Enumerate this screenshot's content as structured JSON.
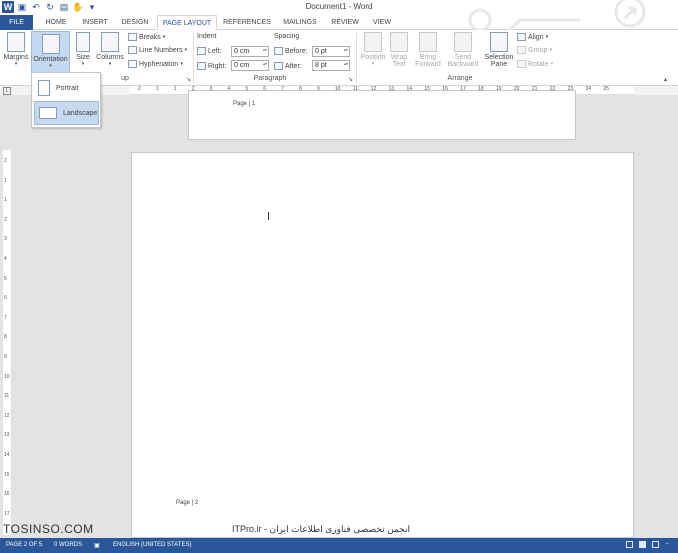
{
  "window": {
    "title": "Document1 - Word"
  },
  "qat": {
    "icons": [
      "word-icon",
      "save-icon",
      "undo-icon",
      "redo-icon",
      "open-icon",
      "touch-mode-icon",
      "customize-icon"
    ]
  },
  "tabs": [
    {
      "label": "FILE"
    },
    {
      "label": "HOME"
    },
    {
      "label": "INSERT"
    },
    {
      "label": "DESIGN"
    },
    {
      "label": "PAGE LAYOUT"
    },
    {
      "label": "REFERENCES"
    },
    {
      "label": "MAILINGS"
    },
    {
      "label": "REVIEW"
    },
    {
      "label": "VIEW"
    }
  ],
  "ribbon": {
    "margins": "Margins",
    "orientation": "Orientation",
    "size": "Size",
    "columns": "Columns",
    "breaks": "Breaks",
    "line_numbers": "Line Numbers",
    "hyphenation": "Hyphenation",
    "page_setup_label": "up",
    "indent_label": "Indent",
    "left_label": "Left:",
    "left_value": "0 cm",
    "right_label": "Right:",
    "right_value": "0 cm",
    "spacing_label": "Spacing",
    "before_label": "Before:",
    "before_value": "0 pt",
    "after_label": "After:",
    "after_value": "8 pt",
    "paragraph_label": "Paragraph",
    "position": "Position",
    "wrap_text_1": "Wrap",
    "wrap_text_2": "Text",
    "bring_forward_1": "Bring",
    "bring_forward_2": "Forward",
    "send_backward_1": "Send",
    "send_backward_2": "Backward",
    "selection_pane_1": "Selection",
    "selection_pane_2": "Pane",
    "align": "Align",
    "group": "Group",
    "rotate": "Rotate",
    "arrange_label": "Arrange"
  },
  "orientation_menu": {
    "portrait": "Portrait",
    "landscape": "Landscape"
  },
  "ruler": {
    "h_numbers": [
      "2",
      "1",
      "1",
      "2",
      "3",
      "4",
      "5",
      "6",
      "7",
      "8",
      "9",
      "10",
      "11",
      "12",
      "13",
      "14",
      "15",
      "16",
      "17",
      "18",
      "19",
      "20",
      "21",
      "22",
      "23",
      "24",
      "25"
    ],
    "v_numbers": [
      "2",
      "1",
      "1",
      "2",
      "3",
      "4",
      "5",
      "6",
      "7",
      "8",
      "9",
      "10",
      "11",
      "12",
      "13",
      "14",
      "15",
      "16",
      "17"
    ]
  },
  "pages": {
    "page1_footer": "Page | 1",
    "page2_footer": "Page | 2"
  },
  "watermark": {
    "site": "TOSINSO.COM",
    "tagline": "ITPro.ir - انجمن تخصصی فناوری اطلاعات ایران"
  },
  "status": {
    "page": "PAGE 2 OF 5",
    "words": "0 WORDS",
    "language": "ENGLISH (UNITED STATES)"
  }
}
